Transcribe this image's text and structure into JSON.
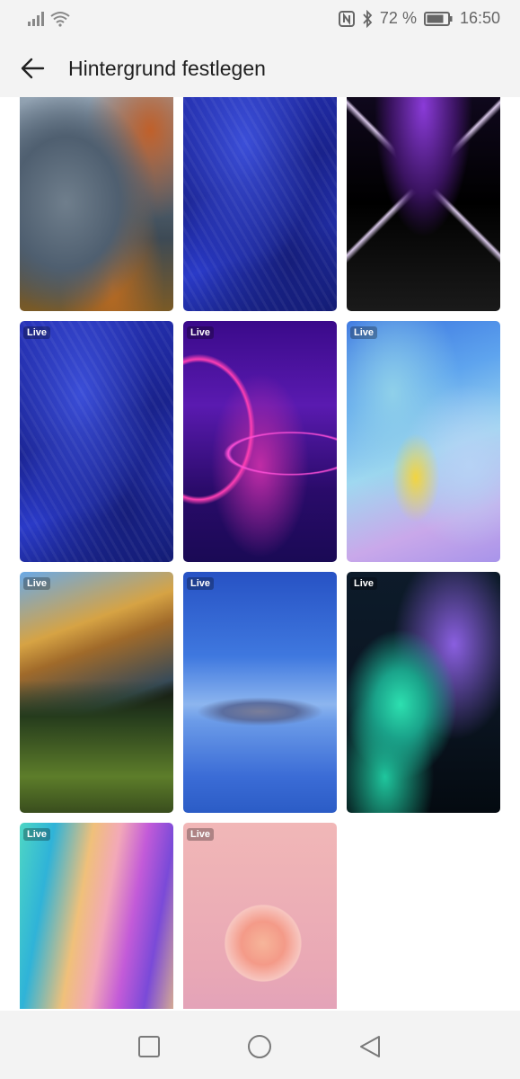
{
  "status_bar": {
    "battery_percent": "72 %",
    "time": "16:50",
    "icons": [
      "signal-icon",
      "wifi-icon",
      "nfc-icon",
      "bluetooth-icon",
      "battery-icon"
    ]
  },
  "app_bar": {
    "title": "Hintergrund festlegen",
    "back_icon": "arrow-left-icon"
  },
  "wallpapers": [
    {
      "name": "wallpaper-mountain-autumn",
      "badge": ""
    },
    {
      "name": "wallpaper-blue-texture",
      "badge": ""
    },
    {
      "name": "wallpaper-neon-tunnel",
      "badge": ""
    },
    {
      "name": "wallpaper-blue-texture-live",
      "badge": "Live"
    },
    {
      "name": "wallpaper-neon-ring",
      "badge": "Live"
    },
    {
      "name": "wallpaper-pastel-wave",
      "badge": "Live"
    },
    {
      "name": "wallpaper-photo-stack",
      "badge": "Live"
    },
    {
      "name": "wallpaper-lake-mountain",
      "badge": "Live"
    },
    {
      "name": "wallpaper-glowing-plants",
      "badge": "Live"
    },
    {
      "name": "wallpaper-fluid-colors",
      "badge": "Live"
    },
    {
      "name": "wallpaper-rose",
      "badge": "Live"
    }
  ],
  "nav_bar": {
    "recent_icon": "square-icon",
    "home_icon": "circle-icon",
    "back_icon": "triangle-back-icon"
  }
}
